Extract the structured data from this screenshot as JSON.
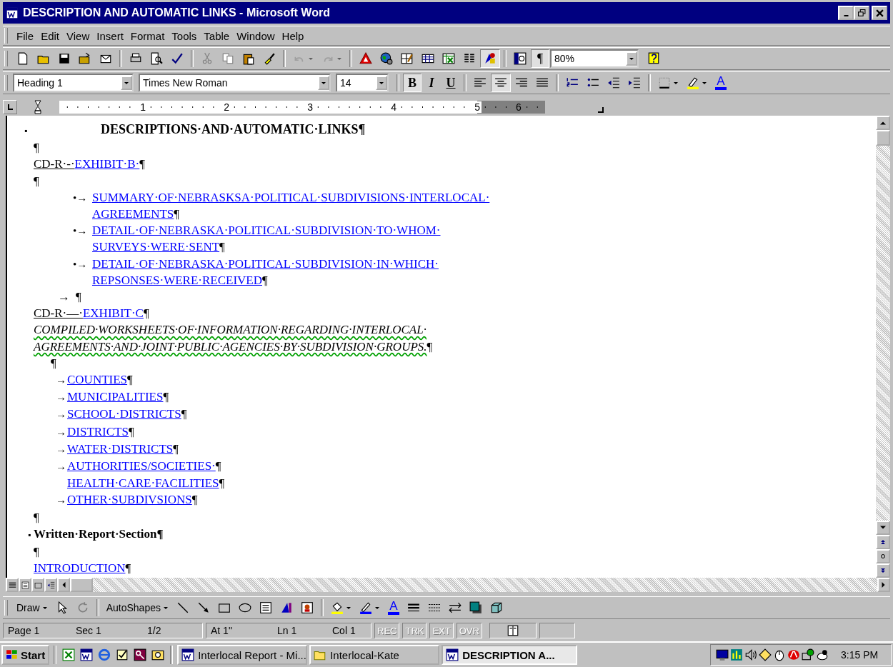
{
  "window": {
    "title": "DESCRIPTION AND AUTOMATIC LINKS - Microsoft Word"
  },
  "menu": [
    "File",
    "Edit",
    "View",
    "Insert",
    "Format",
    "Tools",
    "Table",
    "Window",
    "Help"
  ],
  "standard_toolbar": {
    "undo": {
      "disabled": true
    },
    "redo": {
      "disabled": true
    },
    "drawing": {
      "pressed": true
    },
    "show_marks": {
      "label": "¶",
      "pressed": true
    },
    "zoom": "80%"
  },
  "formatting_toolbar": {
    "style": "Heading 1",
    "font": "Times New Roman",
    "size": "14",
    "text_buttons": [
      {
        "label": "B",
        "pressed": true
      },
      {
        "label": "I",
        "pressed": false
      },
      {
        "label": "U",
        "pressed": false
      }
    ],
    "alignment": [
      {
        "selected": false
      },
      {
        "selected": true
      },
      {
        "selected": false
      },
      {
        "selected": false
      }
    ],
    "font_color": {
      "label": "A",
      "color": "#0000ff"
    }
  },
  "ruler": [
    "1",
    "2",
    "3",
    "4",
    "5",
    "6"
  ],
  "document": [
    {
      "kind": "heading",
      "marker": "▪",
      "text": "DESCRIPTIONS·AND·AUTOMATIC·LINKS¶"
    },
    {
      "kind": "mark",
      "text": "¶"
    },
    {
      "kind": "exhibit",
      "prefix": "CD-R·-·",
      "link": "EXHIBIT·B·",
      "end": "¶"
    },
    {
      "kind": "mark",
      "text": "¶"
    },
    {
      "kind": "bullet",
      "bullet": "•→",
      "lines": [
        "SUMMARY·OF·NEBRASKSA·POLITICAL·SUBDIVISIONS·INTERLOCAL·",
        "AGREEMENTS"
      ],
      "end": "¶"
    },
    {
      "kind": "bullet",
      "bullet": "•→",
      "lines": [
        "DETAIL·OF·NEBRASKA·POLITICAL·SUBDIVISION·TO·WHOM·",
        "SURVEYS·WERE·SENT"
      ],
      "end": "¶"
    },
    {
      "kind": "bullet",
      "bullet": "•→",
      "lines": [
        "DETAIL·OF·NEBRASKA·POLITICAL·SUBDIVISION·IN·WHICH·",
        "REPSONSES·WERE·RECEIVED"
      ],
      "end": "¶"
    },
    {
      "kind": "tab-mark",
      "arrow": "→",
      "text": "¶"
    },
    {
      "kind": "exhibit",
      "prefix": "CD-R·—·",
      "link": "EXHIBIT·C",
      "end": "¶"
    },
    {
      "kind": "italic",
      "lines": [
        "COMPILED·WORKSHEETS·OF·INFORMATION·REGARDING·INTERLOCAL·",
        "AGREEMENTS·AND·JOINT·PUBLIC·AGENCIES·BY·SUBDIVISION·GROUPS."
      ],
      "end": "¶"
    },
    {
      "kind": "indented-mark",
      "text": "¶"
    },
    {
      "kind": "arrow-link",
      "arrow": "→",
      "link": "COUNTIES",
      "end": "¶"
    },
    {
      "kind": "arrow-link",
      "arrow": "→",
      "link": "MUNICIPALITIES",
      "end": "¶"
    },
    {
      "kind": "arrow-link",
      "arrow": "→",
      "link": "SCHOOL·DISTRICTS",
      "end": "¶"
    },
    {
      "kind": "arrow-link",
      "arrow": "→",
      "link": "DISTRICTS",
      "end": "¶"
    },
    {
      "kind": "arrow-link",
      "arrow": "→",
      "link": "WATER·DISTRICTS",
      "end": "¶"
    },
    {
      "kind": "arrow-link",
      "arrow": "→",
      "link": "AUTHORITIES/SOCIETIES·",
      "end": "¶"
    },
    {
      "kind": "continuation",
      "link": "HEALTH·CARE·FACILITIES",
      "end": "¶"
    },
    {
      "kind": "arrow-link",
      "arrow": "→",
      "link": "OTHER·SUBDIVSIONS",
      "end": "¶"
    },
    {
      "kind": "mark",
      "text": "¶"
    },
    {
      "kind": "section",
      "marker": "▪",
      "text": "Written·Report·Section¶"
    },
    {
      "kind": "mark",
      "text": "¶"
    },
    {
      "kind": "link",
      "link": "INTRODUCTION",
      "end": "¶"
    }
  ],
  "drawing_toolbar": {
    "draw": "Draw",
    "autoshapes": "AutoShapes",
    "font_color": {
      "label": "A",
      "color": "#0000ff"
    }
  },
  "status_bar": {
    "cells": [
      "Page 1",
      "Sec 1",
      "1/2",
      "At 1\"",
      "Ln 1",
      "Col 1"
    ],
    "indicators": [
      {
        "label": "REC",
        "active": false
      },
      {
        "label": "TRK",
        "active": false
      },
      {
        "label": "EXT",
        "active": false
      },
      {
        "label": "OVR",
        "active": false
      }
    ]
  },
  "taskbar": {
    "start": "Start",
    "tasks": [
      {
        "label": "Interlocal Report - Mi...",
        "kind": "word",
        "selected": false
      },
      {
        "label": "Interlocal-Kate",
        "kind": "folder",
        "selected": false
      },
      {
        "label": "DESCRIPTION A...",
        "kind": "word",
        "selected": true
      }
    ],
    "time": "3:15 PM"
  }
}
